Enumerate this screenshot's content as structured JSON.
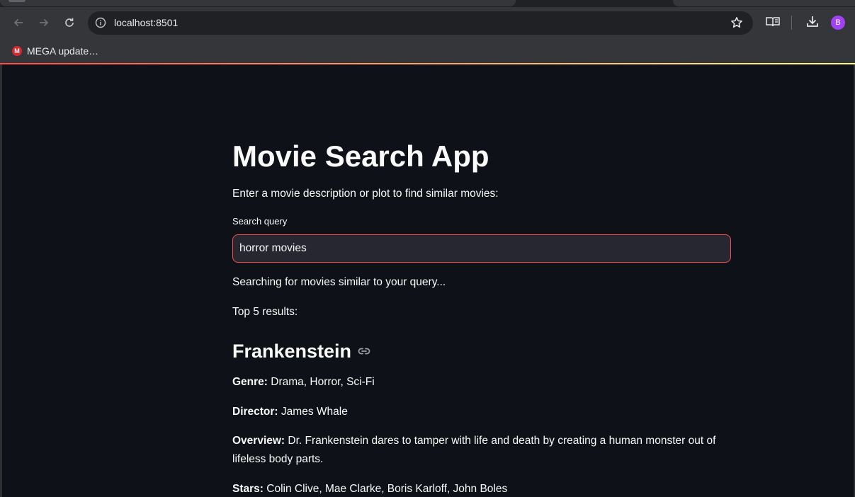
{
  "browser": {
    "url": "localhost:8501",
    "profile_initial": "B",
    "bookmarks": [
      {
        "label": "MEGA update…",
        "icon": "mega-logo",
        "icon_text": "M"
      }
    ]
  },
  "colors": {
    "background": "#0e1117",
    "accent": "#ff4b4b",
    "input_bg": "#262730",
    "text": "#fafafa"
  },
  "app": {
    "title": "Movie Search App",
    "intro": "Enter a movie description or plot to find similar movies:",
    "search": {
      "label": "Search query",
      "value": "horror movies"
    },
    "status": "Searching for movies similar to your query...",
    "results_header": "Top 5 results:",
    "results": [
      {
        "title": "Frankenstein",
        "genre_label": "Genre:",
        "genre": "Drama, Horror, Sci-Fi",
        "director_label": "Director:",
        "director": "James Whale",
        "overview_label": "Overview:",
        "overview": "Dr. Frankenstein dares to tamper with life and death by creating a human monster out of lifeless body parts.",
        "stars_label": "Stars:",
        "stars": "Colin Clive, Mae Clarke, Boris Karloff, John Boles"
      }
    ]
  }
}
